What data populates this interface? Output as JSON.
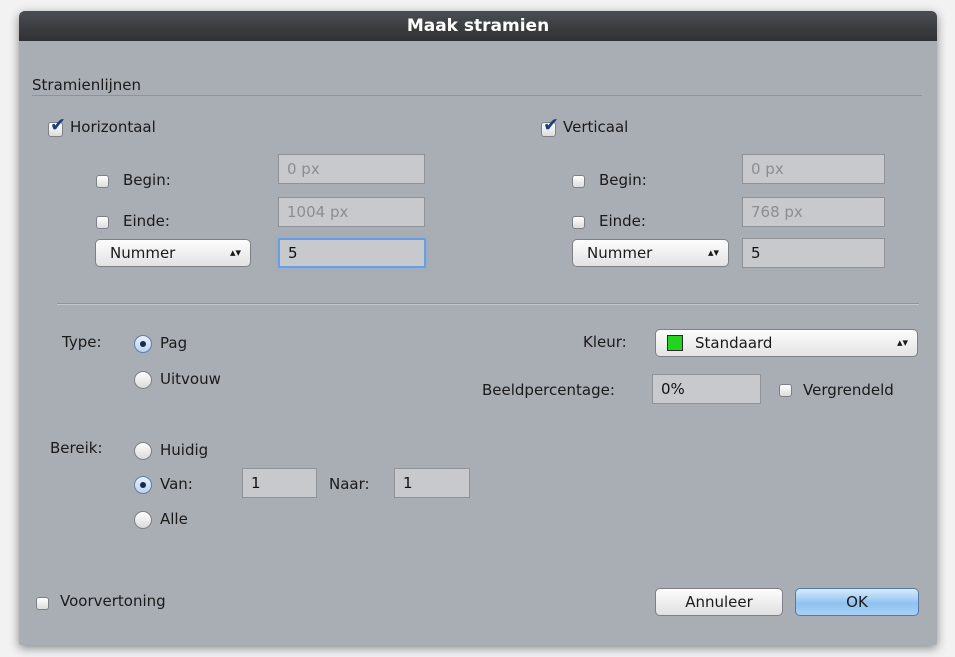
{
  "dialog": {
    "title": "Maak stramien",
    "section_title": "Stramienlijnen",
    "horizontal": {
      "label": "Horizontaal",
      "checked": true,
      "begin_label": "Begin:",
      "begin_value": "0 px",
      "end_label": "Einde:",
      "end_value": "1004 px",
      "mode": "Nummer",
      "count": "5"
    },
    "vertical": {
      "label": "Verticaal",
      "checked": true,
      "begin_label": "Begin:",
      "begin_value": "0 px",
      "end_label": "Einde:",
      "end_value": "768 px",
      "mode": "Nummer",
      "count": "5"
    },
    "type": {
      "label": "Type:",
      "options": [
        "Pag",
        "Uitvouw"
      ],
      "selected": "Pag"
    },
    "color": {
      "label": "Kleur:",
      "value": "Standaard",
      "swatch": "#22d41f"
    },
    "opacity": {
      "label": "Beeldpercentage:",
      "value": "0%",
      "lock_label": "Vergrendeld"
    },
    "range": {
      "label": "Bereik:",
      "options": [
        "Huidig",
        "Van:",
        "Alle"
      ],
      "selected": "Van:",
      "from_value": "1",
      "to_label": "Naar:",
      "to_value": "1"
    },
    "preview_label": "Voorvertoning",
    "cancel_label": "Annuleer",
    "ok_label": "OK"
  },
  "icons": {
    "checkmark": "✔",
    "popup_arrows": "⌃⌄"
  }
}
